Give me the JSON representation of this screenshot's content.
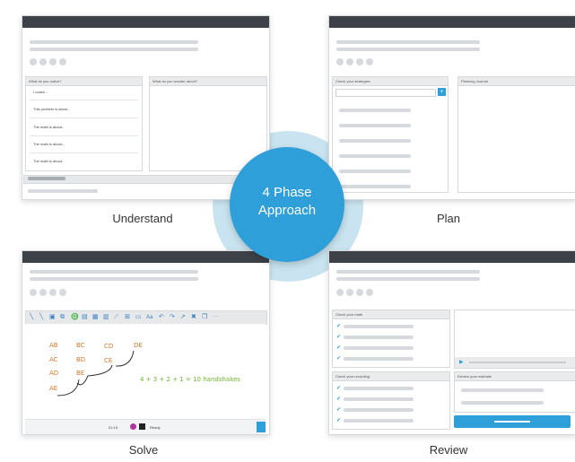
{
  "center": {
    "line1": "4 Phase",
    "line2": "Approach"
  },
  "captions": {
    "understand": "Understand",
    "plan": "Plan",
    "solve": "Solve",
    "review": "Review"
  },
  "understand": {
    "notice_title": "What do you notice?",
    "wonder_title": "What do you wonder about?",
    "notice_items": [
      "I notice...",
      "This problem is about...",
      "The math is about...",
      "The math is about...",
      "The math is about..."
    ]
  },
  "plan": {
    "strategies_title": "Check your strategies",
    "journal_title": "Planning Journal",
    "add_button": "+"
  },
  "solve": {
    "pairs": [
      "AB",
      "BC",
      "CD",
      "DE",
      "AC",
      "BD",
      "CE",
      "AD",
      "BE",
      "AE"
    ],
    "equation": "4 + 3 + 2 + 1 = 10 handshakes",
    "timer": "01:15",
    "status": "Ready",
    "toolbar_text_tool": "Aa"
  },
  "review": {
    "math_title": "Check your math",
    "recording_title": "Check your recording",
    "estimate_title": "Review your estimate"
  },
  "colors": {
    "accent": "#2e9fd8",
    "titlebar": "#3d4148",
    "ring": "#c9e4f0",
    "pairs": "#d6782e",
    "equation": "#6cb52d"
  }
}
